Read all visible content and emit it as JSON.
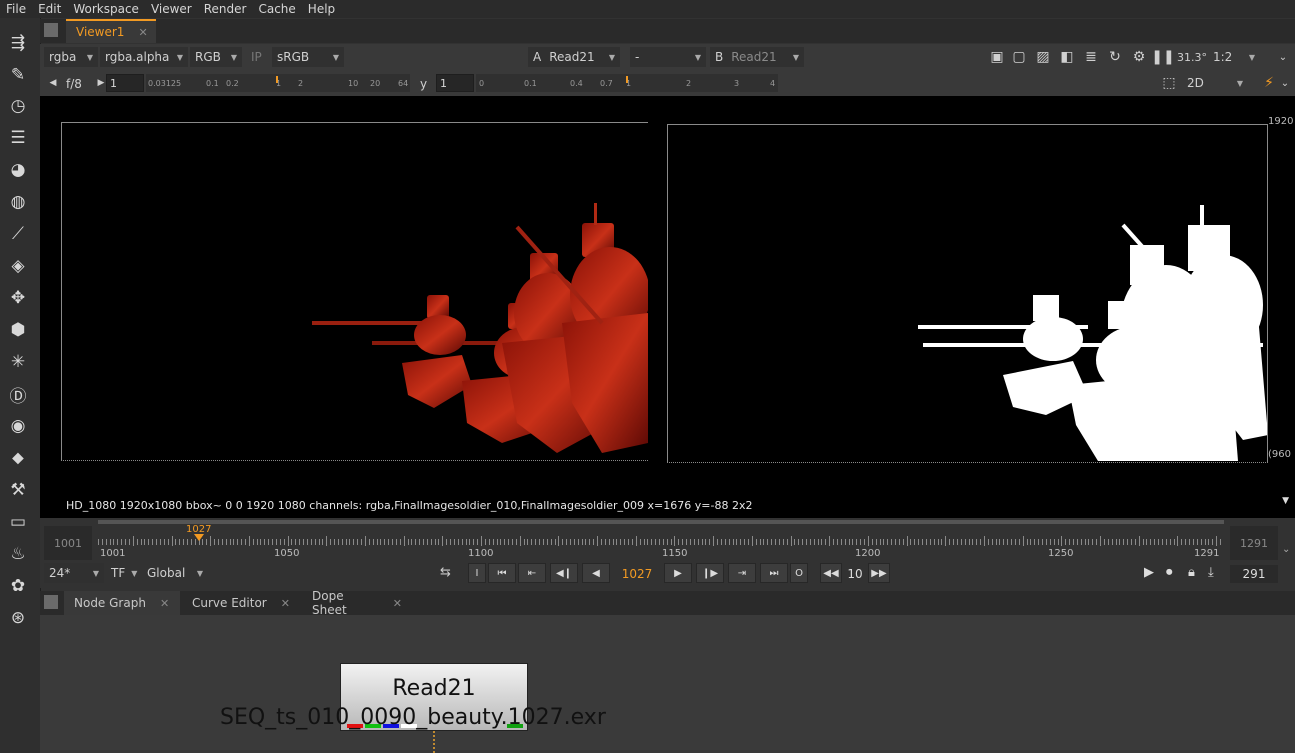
{
  "menu": [
    "File",
    "Edit",
    "Workspace",
    "Viewer",
    "Render",
    "Cache",
    "Help"
  ],
  "viewer_tab": {
    "label": "Viewer1"
  },
  "toolbar1": {
    "channels": "rgba",
    "channel_alpha": "rgba.alpha",
    "display_channels": "RGB",
    "ip": "IP",
    "colorspace": "sRGB",
    "input_a_letter": "A",
    "input_a": "Read21",
    "operation": "-",
    "input_b_letter": "B",
    "input_b": "Read21",
    "zoom": "31.3°",
    "proxy": "1:2"
  },
  "toolbar2": {
    "fstop": "f/8",
    "gain": "1",
    "gamma_label": "y",
    "gamma": "1",
    "gain_ticks": [
      "0.03125",
      "0.1",
      "0.2",
      "1",
      "2",
      "10",
      "20",
      "64"
    ],
    "gamma_ticks": [
      "0",
      "0.1",
      "0.4",
      "0.7",
      "1",
      "2",
      "3",
      "4"
    ],
    "view_mode": "2D"
  },
  "viewer": {
    "right_label_top": "1920",
    "right_label_bottom": "(960"
  },
  "info_text": "HD_1080 1920x1080  bbox~ 0 0 1920 1080 channels: rgba,FinalImagesoldier_010,FinalImagesoldier_009  x=1676 y=-88 2x2",
  "timeline": {
    "in_frame": "1001",
    "out_frame": "1291",
    "current_marker": "1027",
    "labels": [
      "1001",
      "1050",
      "1100",
      "1150",
      "1200",
      "1250",
      "1291"
    ]
  },
  "playback": {
    "fps": "24*",
    "timecode_mode": "TF",
    "scope": "Global",
    "current_frame": "1027",
    "skip": "10",
    "end_frame": "291"
  },
  "ng_tabs": [
    "Node Graph",
    "Curve Editor",
    "Dope Sheet"
  ],
  "node": {
    "name": "Read21",
    "file": "SEQ_ts_010_0090_beauty.1027.exr"
  },
  "colors": {
    "accent": "#f29a23",
    "bg": "#323232",
    "viewer_bg": "#000000"
  }
}
